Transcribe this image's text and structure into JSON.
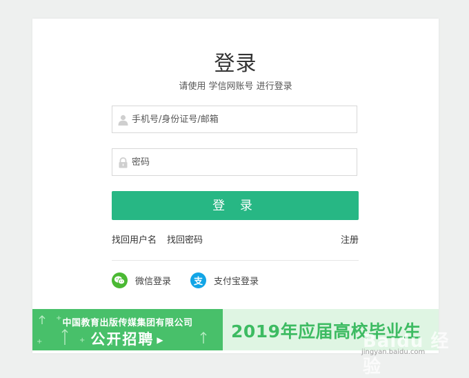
{
  "login": {
    "title": "登录",
    "subtitle": "请使用 学信网账号 进行登录",
    "username_placeholder": "手机号/身份证号/邮箱",
    "password_placeholder": "密码",
    "submit_label": "登 录"
  },
  "links": {
    "find_username": "找回用户名",
    "find_password": "找回密码",
    "register": "注册"
  },
  "social": {
    "wechat_label": "微信登录",
    "alipay_label": "支付宝登录",
    "alipay_glyph": "支"
  },
  "banner": {
    "org": "中国教育出版传媒集团有限公司",
    "cta": "公开招聘",
    "headline": "2019年应届高校毕业生"
  },
  "watermark": {
    "brand": "Baidu 经验",
    "url": "jingyan.baidu.com"
  },
  "colors": {
    "accent": "#27b784",
    "wechat": "#4bb934",
    "alipay": "#12a5e6",
    "banner_green": "#48c06a"
  }
}
